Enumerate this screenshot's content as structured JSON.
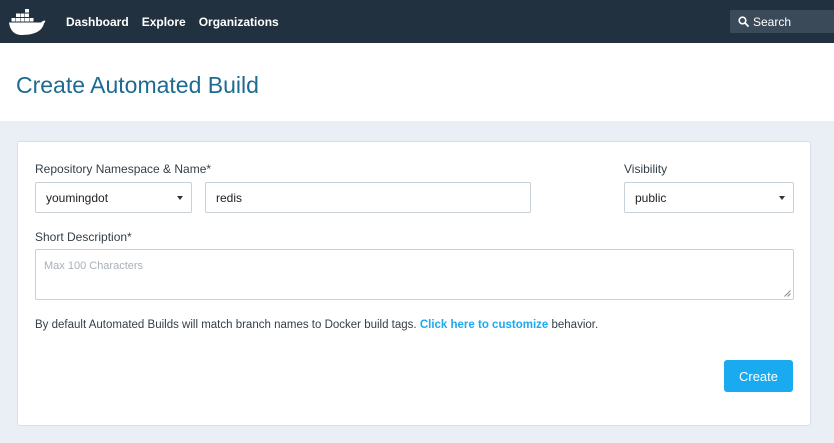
{
  "nav": {
    "items": [
      "Dashboard",
      "Explore",
      "Organizations"
    ],
    "search_label": "Search"
  },
  "page": {
    "title": "Create Automated Build"
  },
  "form": {
    "namespace_label": "Repository Namespace & Name*",
    "namespace_value": "youmingdot",
    "name_value": "redis",
    "visibility_label": "Visibility",
    "visibility_value": "public",
    "description_label": "Short Description*",
    "description_placeholder": "Max 100 Characters",
    "help_prefix": "By default Automated Builds will match branch names to Docker build tags.",
    "help_link": "Click here to customize",
    "help_suffix": "behavior.",
    "create_label": "Create"
  },
  "colors": {
    "topbar": "#22313f",
    "title": "#1d6a92",
    "accent": "#1aaaf0",
    "band": "#e9eff5"
  }
}
